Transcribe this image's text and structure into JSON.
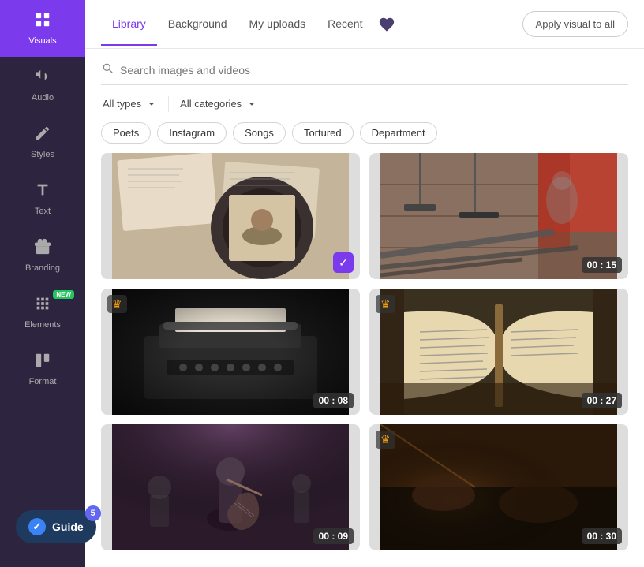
{
  "sidebar": {
    "items": [
      {
        "id": "visuals",
        "label": "Visuals",
        "icon": "🖼",
        "active": true
      },
      {
        "id": "audio",
        "label": "Audio",
        "icon": "🎵",
        "active": false
      },
      {
        "id": "styles",
        "label": "Styles",
        "icon": "🎨",
        "active": false
      },
      {
        "id": "text",
        "label": "Text",
        "icon": "T",
        "active": false
      },
      {
        "id": "branding",
        "label": "Branding",
        "icon": "💼",
        "active": false
      },
      {
        "id": "elements",
        "label": "Elements",
        "icon": "✦",
        "active": false,
        "badge": "NEW"
      },
      {
        "id": "format",
        "label": "Format",
        "icon": "📐",
        "active": false
      }
    ]
  },
  "header": {
    "tabs": [
      {
        "id": "library",
        "label": "Library",
        "active": true
      },
      {
        "id": "background",
        "label": "Background",
        "active": false
      },
      {
        "id": "my-uploads",
        "label": "My uploads",
        "active": false
      },
      {
        "id": "recent",
        "label": "Recent",
        "active": false
      }
    ],
    "apply_button": "Apply visual to all"
  },
  "search": {
    "placeholder": "Search images and videos"
  },
  "filters": {
    "type_label": "All types",
    "category_label": "All categories"
  },
  "tags": [
    "Poets",
    "Instagram",
    "Songs",
    "Tortured",
    "Department"
  ],
  "media_items": [
    {
      "id": 1,
      "type": "image",
      "has_duration": false,
      "has_crown": false,
      "selected": true,
      "bg_color": "#b8a88a"
    },
    {
      "id": 2,
      "type": "video",
      "duration": "00 : 15",
      "has_crown": false,
      "selected": false,
      "bg_color": "#8b6b5a"
    },
    {
      "id": 3,
      "type": "video",
      "duration": "00 : 08",
      "has_crown": true,
      "selected": false,
      "bg_color": "#2a2a2a"
    },
    {
      "id": 4,
      "type": "video",
      "duration": "00 : 27",
      "has_crown": true,
      "selected": false,
      "bg_color": "#7a6a4a"
    },
    {
      "id": 5,
      "type": "video",
      "duration": "00 : 09",
      "has_crown": false,
      "selected": false,
      "bg_color": "#5a3a5a"
    },
    {
      "id": 6,
      "type": "video",
      "duration": "00 : 30",
      "has_crown": true,
      "selected": false,
      "bg_color": "#4a3a2a"
    }
  ],
  "guide": {
    "label": "Guide",
    "badge": "5"
  }
}
